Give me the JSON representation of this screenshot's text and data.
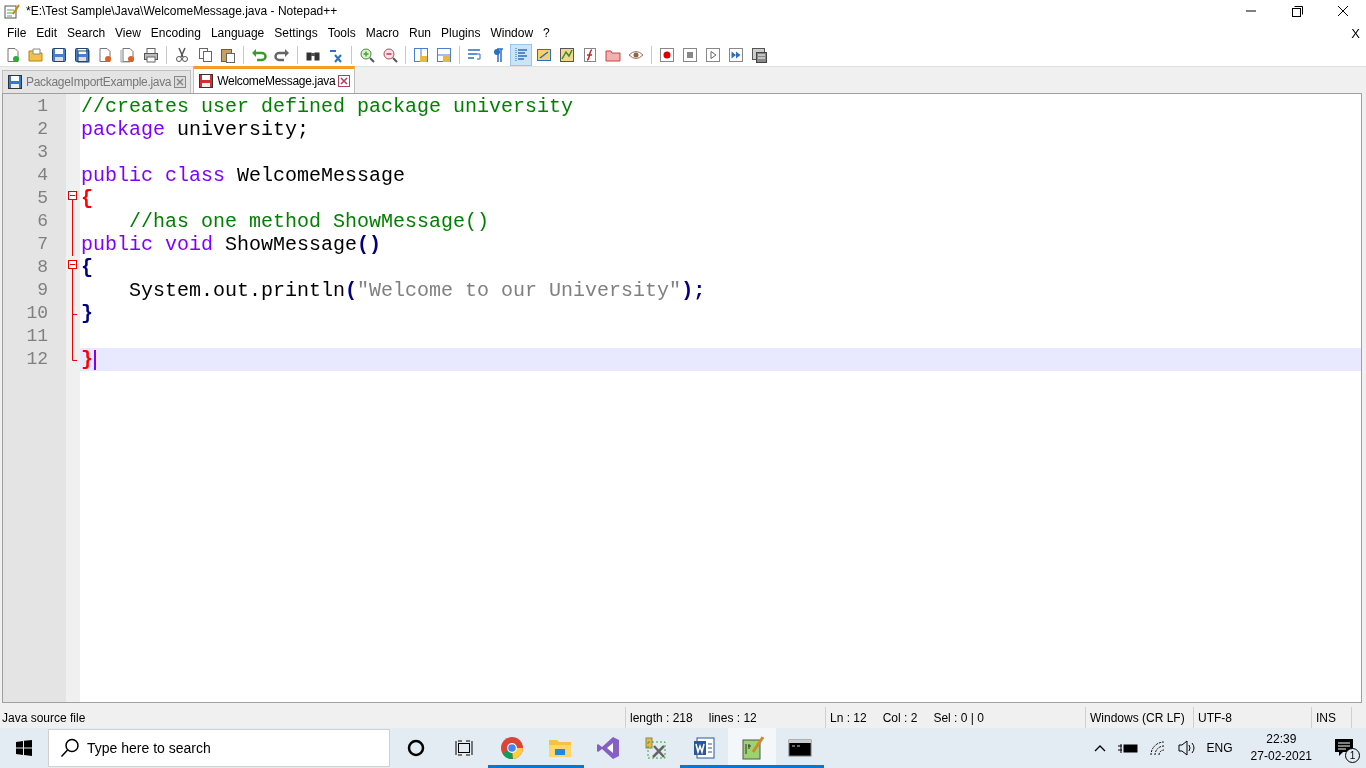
{
  "window": {
    "title": "*E:\\Test Sample\\Java\\WelcomeMessage.java - Notepad++"
  },
  "menu": [
    "File",
    "Edit",
    "Search",
    "View",
    "Encoding",
    "Language",
    "Settings",
    "Tools",
    "Macro",
    "Run",
    "Plugins",
    "Window",
    "?"
  ],
  "menu_close": "X",
  "toolbar": [
    [
      {
        "pressed": false
      },
      {
        "pressed": false
      },
      {
        "pressed": false
      },
      {
        "pressed": false
      },
      {
        "pressed": false
      },
      {
        "pressed": false
      },
      {
        "pressed": false
      }
    ],
    [
      {
        "pressed": false
      },
      {
        "pressed": false
      },
      {
        "pressed": false
      }
    ],
    [
      {
        "pressed": false
      },
      {
        "pressed": false
      }
    ],
    [
      {
        "pressed": false
      },
      {
        "pressed": false
      }
    ],
    [
      {
        "pressed": false
      },
      {
        "pressed": false
      }
    ],
    [
      {
        "pressed": false
      },
      {
        "pressed": false
      }
    ],
    [
      {
        "pressed": false
      },
      {
        "pressed": false
      },
      {
        "pressed": true
      },
      {
        "pressed": false
      },
      {
        "pressed": false
      },
      {
        "pressed": false
      },
      {
        "pressed": false
      },
      {
        "pressed": false
      }
    ],
    [
      {
        "pressed": false
      },
      {
        "pressed": false
      },
      {
        "pressed": false
      },
      {
        "pressed": false
      },
      {
        "pressed": false
      }
    ]
  ],
  "tabs": [
    {
      "label": "PackageImportExample.java",
      "selected": false,
      "modified": false
    },
    {
      "label": "WelcomeMessage.java",
      "selected": true,
      "modified": true
    }
  ],
  "editor": {
    "lines": [
      {
        "number": "1",
        "current": false,
        "tokens": [
          {
            "kind": "comment",
            "text": "//creates user defined package university"
          }
        ]
      },
      {
        "number": "2",
        "current": false,
        "tokens": [
          {
            "kind": "keyword",
            "text": "package"
          },
          {
            "kind": "plain",
            "text": " university;"
          }
        ]
      },
      {
        "number": "3",
        "current": false
      },
      {
        "number": "4",
        "current": false,
        "tokens": [
          {
            "kind": "keyword",
            "text": "public class"
          },
          {
            "kind": "plain",
            "text": " WelcomeMessage"
          }
        ]
      },
      {
        "number": "5",
        "current": false,
        "fold": {
          "kind": "box"
        },
        "tokens": [
          {
            "kind": "match",
            "text": "{"
          }
        ]
      },
      {
        "number": "6",
        "current": false,
        "fold": {
          "kind": "line"
        },
        "indented": true,
        "tokens": [
          {
            "kind": "comment",
            "text": "//has one method ShowMessage()"
          }
        ]
      },
      {
        "number": "7",
        "current": false,
        "fold": {
          "kind": "line"
        },
        "tokens": [
          {
            "kind": "keyword",
            "text": "public void"
          },
          {
            "kind": "plain",
            "text": " ShowMessage"
          },
          {
            "kind": "operator",
            "text": "()"
          }
        ]
      },
      {
        "number": "8",
        "current": false,
        "fold": {
          "kind": "box"
        },
        "tokens": [
          {
            "kind": "operator",
            "text": "{"
          }
        ]
      },
      {
        "number": "9",
        "current": false,
        "fold": {
          "kind": "line"
        },
        "indented": true,
        "tokens": [
          {
            "kind": "plain",
            "text": "System.out.println"
          },
          {
            "kind": "operator",
            "text": "("
          },
          {
            "kind": "string",
            "text": "\"Welcome to our University\""
          },
          {
            "kind": "operator",
            "text": ");"
          }
        ]
      },
      {
        "number": "10",
        "current": false,
        "fold": {
          "kind": "branch"
        },
        "tokens": [
          {
            "kind": "operator",
            "text": "}"
          }
        ]
      },
      {
        "number": "11",
        "current": false,
        "fold": {
          "kind": "line"
        }
      },
      {
        "number": "12",
        "current": true,
        "fold": {
          "kind": "end"
        },
        "tokens": [
          {
            "kind": "match",
            "text": "}"
          }
        ]
      }
    ]
  },
  "status_bar": {
    "file_type": "Java source file",
    "length": "length : 218",
    "lines": "lines : 12",
    "ln": "Ln : 12",
    "col": "Col : 2",
    "sel": "Sel : 0 | 0",
    "eol": "Windows (CR LF)",
    "encoding": "UTF-8",
    "mode": "INS"
  },
  "taskbar": {
    "search": {
      "placeholder": "Type here to search"
    },
    "apps": [
      {
        "running": true,
        "active": false
      },
      {
        "running": true,
        "active": false
      },
      {
        "running": false,
        "active": false
      },
      {
        "running": false,
        "active": false
      },
      {
        "running": true,
        "active": false
      },
      {
        "running": true,
        "active": true
      },
      {
        "running": true,
        "active": false
      }
    ],
    "language": "ENG",
    "time": "22:39",
    "date": "27-02-2021",
    "notifications": "1"
  }
}
